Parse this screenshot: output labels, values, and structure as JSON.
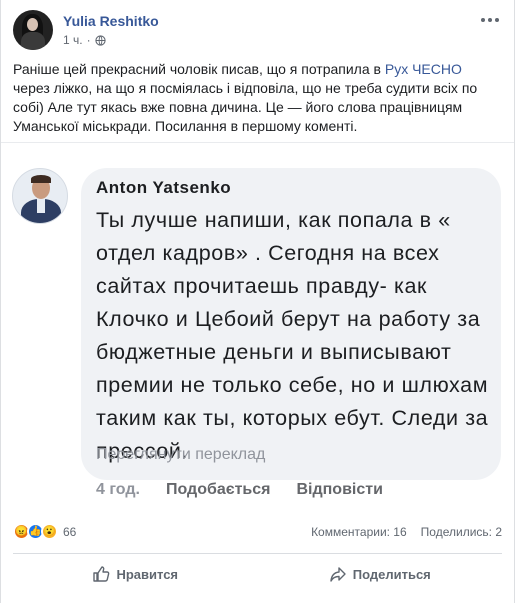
{
  "post": {
    "author": "Yulia Reshitko",
    "time": "1 ч.",
    "privacy_icon": "globe-icon",
    "text_before_link": "Раніше цей прекрасний чоловік писав, що я потрапила в ",
    "link_text": "Рух ЧЕСНО",
    "text_after_link": " через ліжко, на що я посміялась і відповіла, що не треба судити всіх по собі) Але тут якась вже повна дичина. Це — його слова працівницям Уманської міськради. Посилання в першому коменті."
  },
  "screenshot": {
    "commenter": "Anton  Yatsenko",
    "comment_text": "Ты лучше напиши, как попала в « отдел кадров» . Сегодня на всех сайтах прочитаешь правду- как Клочко и Цебоий берут на работу за бюджетные деньги и выписывают премии не только себе, но и шлюхам таким как ты, которых ебут. Следи за прессой.",
    "translate": "Переглянути переклад",
    "time": "4 год.",
    "like": "Подобається",
    "reply": "Відповісти"
  },
  "stats": {
    "reactions": [
      "angry",
      "like",
      "wow"
    ],
    "reaction_count": "66",
    "comments": "Комментарии: 16",
    "shares": "Поделились: 2"
  },
  "actions": {
    "like": "Нравится",
    "share": "Поделиться"
  },
  "colors": {
    "link": "#385898",
    "bubble": "#f0f2f5",
    "muted": "#606770"
  }
}
